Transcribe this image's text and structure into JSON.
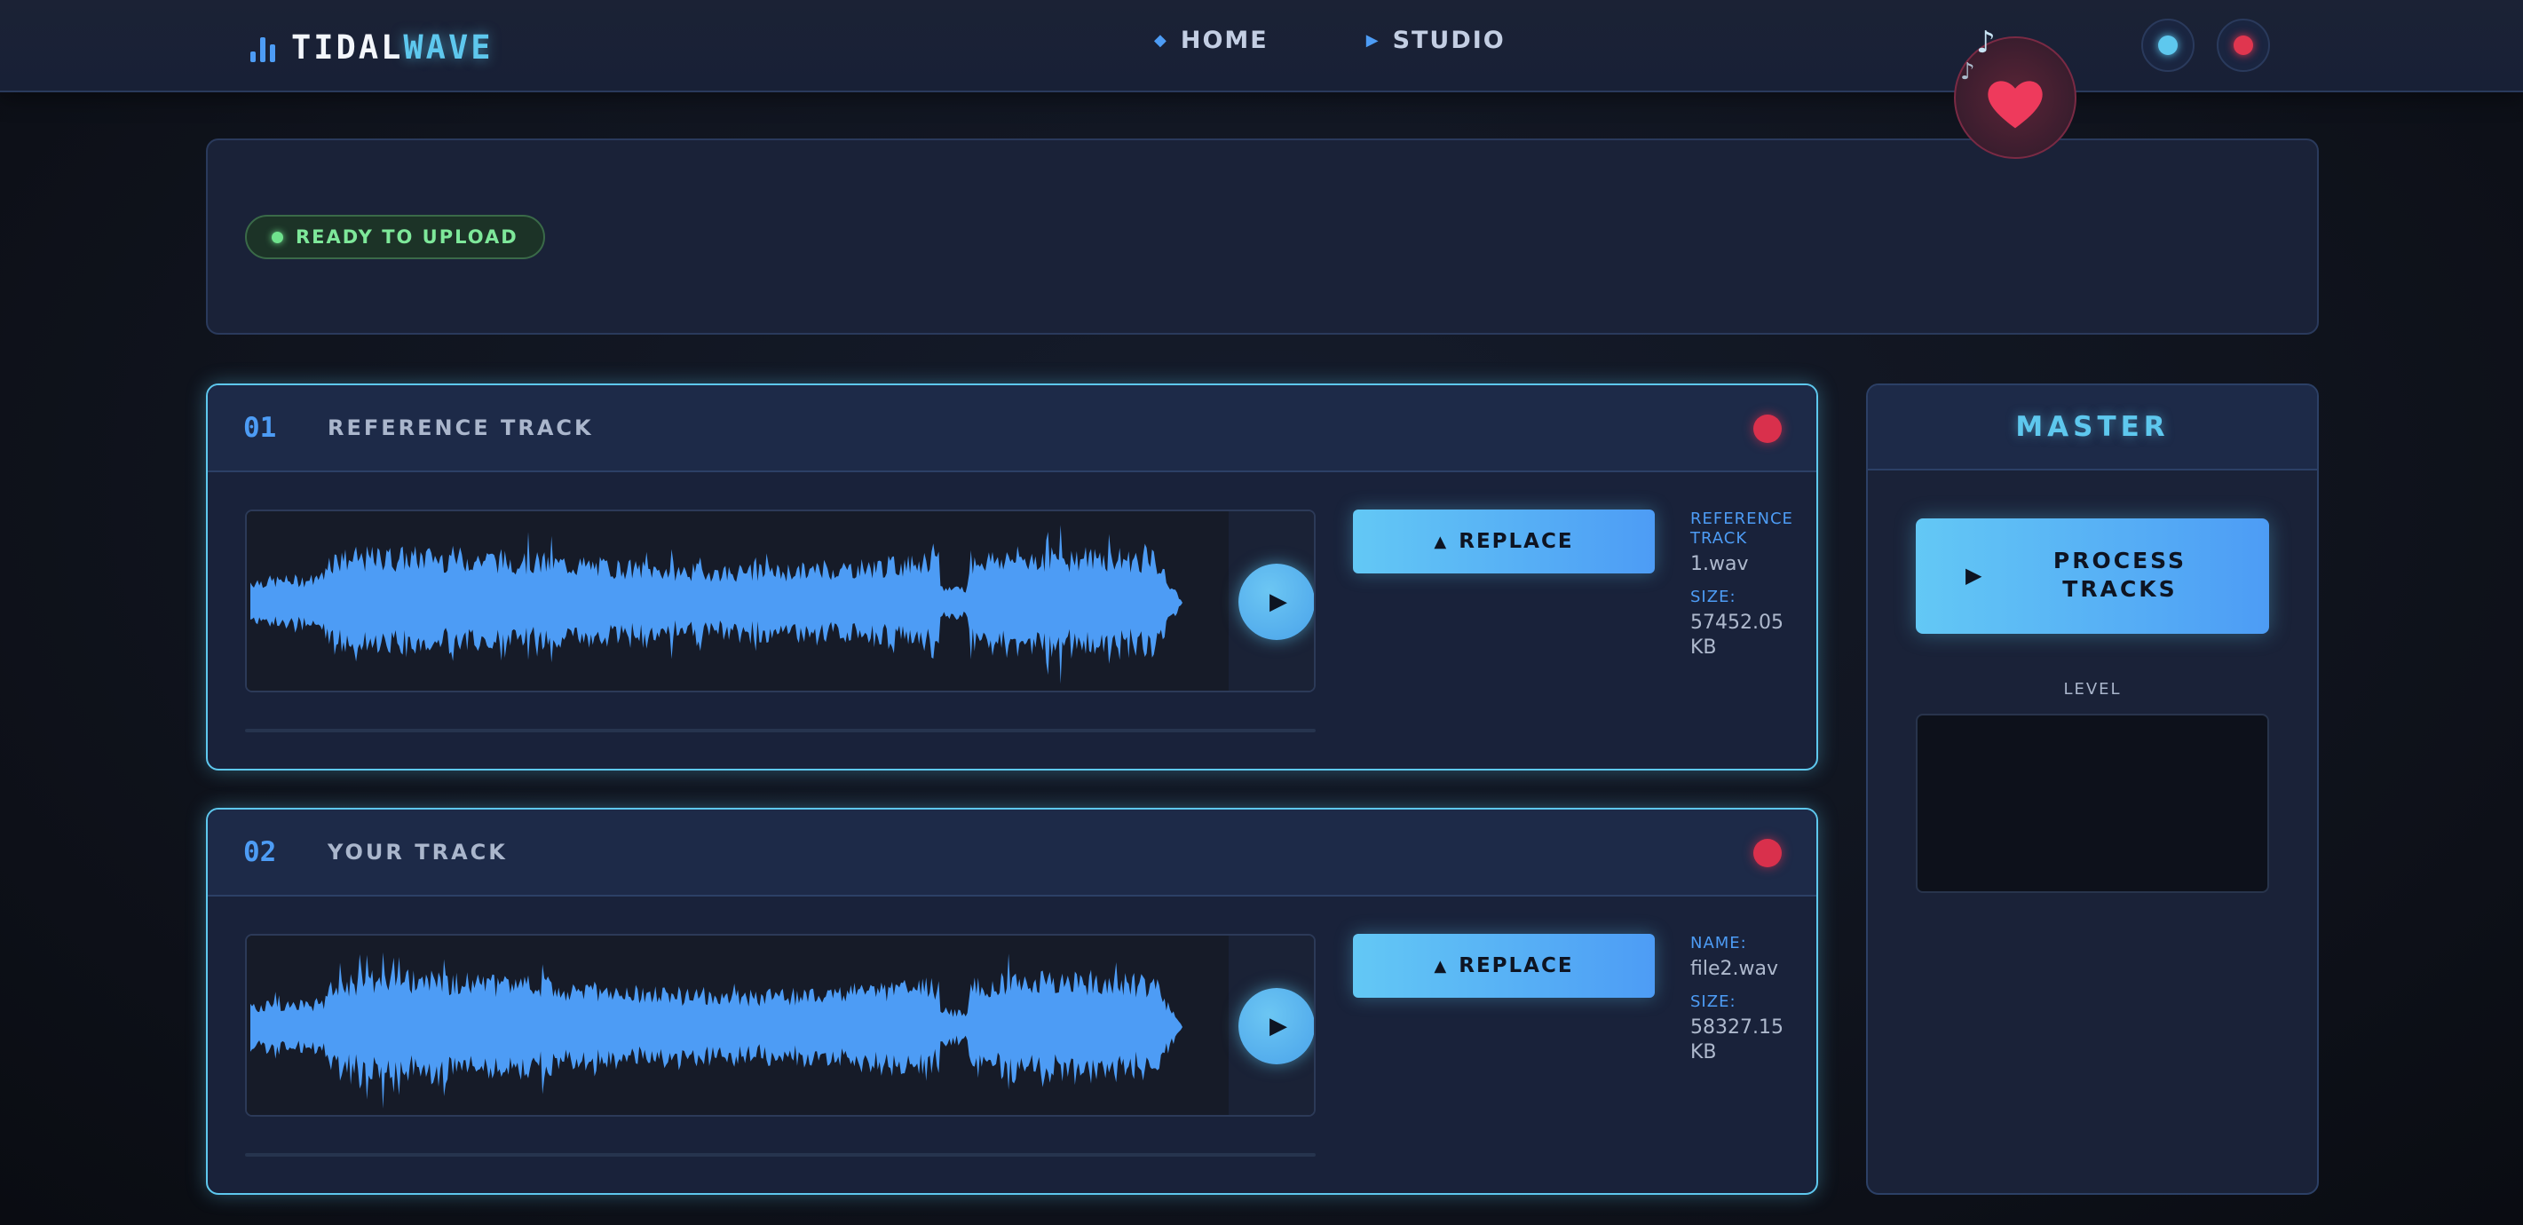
{
  "nav": {
    "logo_part1": "TIDAL",
    "logo_part2": "WAVE",
    "links": [
      {
        "label": "HOME",
        "icon": "diamond-icon"
      },
      {
        "label": "STUDIO",
        "icon": "triangle-right-icon"
      }
    ],
    "accent_color": "#5ec8ee",
    "record_color": "#e0364f"
  },
  "status": {
    "label": "READY TO UPLOAD",
    "color": "#7ee89a"
  },
  "tracks": [
    {
      "number": "01",
      "title": "REFERENCE TRACK",
      "replace_label": "REPLACE",
      "meta_key1": "REFERENCE TRACK",
      "meta_val1": "1.wav",
      "meta_key2": "SIZE:",
      "meta_val2": "57452.05 KB"
    },
    {
      "number": "02",
      "title": "YOUR TRACK",
      "replace_label": "REPLACE",
      "meta_key1": "NAME:",
      "meta_val1": "file2.wav",
      "meta_key2": "SIZE:",
      "meta_val2": "58327.15 KB"
    }
  ],
  "master": {
    "title": "MASTER",
    "process_label": "PROCESS TRACKS",
    "level_label": "LEVEL"
  }
}
